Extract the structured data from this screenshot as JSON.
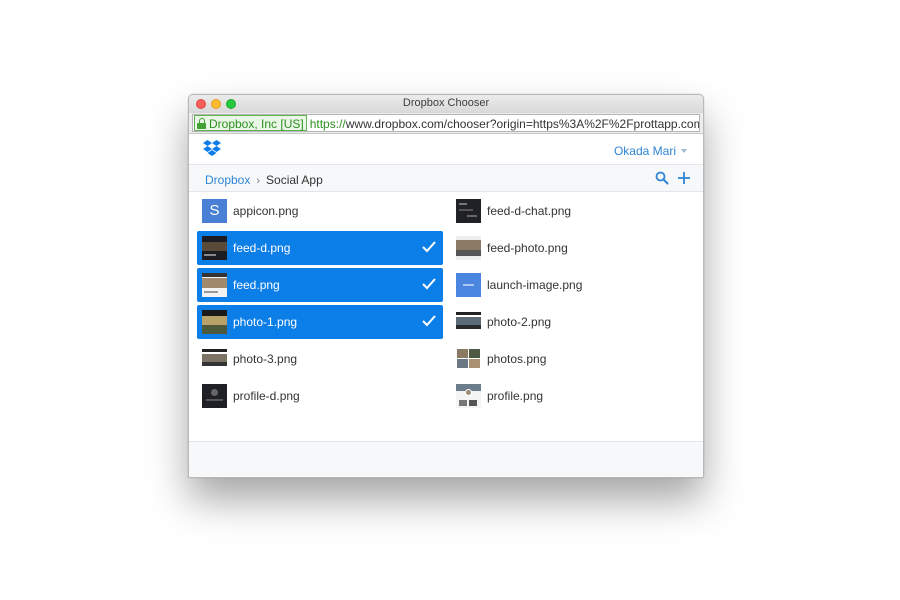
{
  "window": {
    "title": "Dropbox Chooser"
  },
  "address_bar": {
    "ev_label": "Dropbox, Inc [US]",
    "url_scheme": "https://",
    "url_rest": "www.dropbox.com/chooser?origin=https%3A%2F%2Fprottapp.com..."
  },
  "header": {
    "user_name": "Okada Mari"
  },
  "breadcrumb": {
    "root": "Dropbox",
    "separator": "›",
    "current": "Social App"
  },
  "files": [
    {
      "name": "appicon.png",
      "selected": false,
      "thumb": "s-icon-thumb"
    },
    {
      "name": "feed-d-chat.png",
      "selected": false,
      "thumb": "dark-thumb"
    },
    {
      "name": "feed-d.png",
      "selected": true,
      "thumb": "dark-thumb"
    },
    {
      "name": "feed-photo.png",
      "selected": false,
      "thumb": "photo-thumb"
    },
    {
      "name": "feed.png",
      "selected": true,
      "thumb": "light-thumb"
    },
    {
      "name": "launch-image.png",
      "selected": false,
      "thumb": "blue-thumb"
    },
    {
      "name": "photo-1.png",
      "selected": true,
      "thumb": "landscape-thumb"
    },
    {
      "name": "photo-2.png",
      "selected": false,
      "thumb": "strip-thumb"
    },
    {
      "name": "photo-3.png",
      "selected": false,
      "thumb": "strip-thumb"
    },
    {
      "name": "photos.png",
      "selected": false,
      "thumb": "grid-thumb"
    },
    {
      "name": "profile-d.png",
      "selected": false,
      "thumb": "dark-thumb"
    },
    {
      "name": "profile.png",
      "selected": false,
      "thumb": "light-thumb"
    }
  ],
  "colors": {
    "selection": "#0c7ee8",
    "link": "#2f86d6",
    "ev_green": "#2e8f22"
  },
  "icons": {
    "lock": "lock-icon",
    "logo": "dropbox-logo-icon",
    "search": "search-icon",
    "add": "plus-icon",
    "check": "checkmark-icon",
    "user_caret": "chevron-down-icon"
  }
}
